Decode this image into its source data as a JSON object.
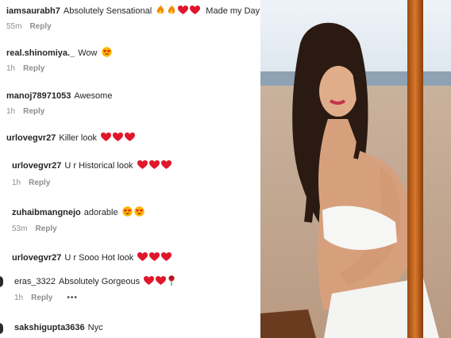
{
  "comments": [
    {
      "user": "iamsaurabh7",
      "text": "Absolutely Sensational",
      "emojis": [
        "fire",
        "fire",
        "heart",
        "heart"
      ],
      "suffix": "Made my Day",
      "time": "55m",
      "reply": "Reply"
    },
    {
      "user": "real.shinomiya._",
      "text": "Wow",
      "emojis": [
        "heart-eyes"
      ],
      "suffix": "",
      "time": "1h",
      "reply": "Reply"
    },
    {
      "user": "manoj78971053",
      "text": "Awesome",
      "emojis": [],
      "suffix": "",
      "time": "1h",
      "reply": "Reply"
    },
    {
      "user": "urlovegvr27",
      "text": "Killer look",
      "emojis": [
        "heart",
        "heart",
        "heart"
      ],
      "suffix": "",
      "time": "",
      "reply": ""
    },
    {
      "user": "urlovegvr27",
      "text": "U r Historical look",
      "emojis": [
        "heart",
        "heart",
        "heart"
      ],
      "suffix": "",
      "time": "1h",
      "reply": "Reply"
    },
    {
      "user": "zuhaibmangnejo",
      "text": "adorable",
      "emojis": [
        "heart-eyes",
        "heart-eyes"
      ],
      "suffix": "",
      "time": "53m",
      "reply": "Reply"
    },
    {
      "user": "urlovegvr27",
      "text": "U r Sooo Hot look",
      "emojis": [
        "heart",
        "heart",
        "heart"
      ],
      "suffix": "",
      "time": "",
      "reply": ""
    },
    {
      "user": "eras_3322",
      "text": "Absolutely Gorgeous",
      "emojis": [
        "heart",
        "heart",
        "rose"
      ],
      "suffix": "",
      "time": "1h",
      "reply": "Reply",
      "more": "•••"
    },
    {
      "user": "sakshigupta3636",
      "text": "Nyc",
      "emojis": [],
      "suffix": "",
      "time": "",
      "reply": ""
    }
  ],
  "colors": {
    "heart": "#e0162b",
    "fire": "#f08a00",
    "emoji_face": "#ffb400",
    "text": "#262626",
    "muted": "#8e8e8e"
  }
}
